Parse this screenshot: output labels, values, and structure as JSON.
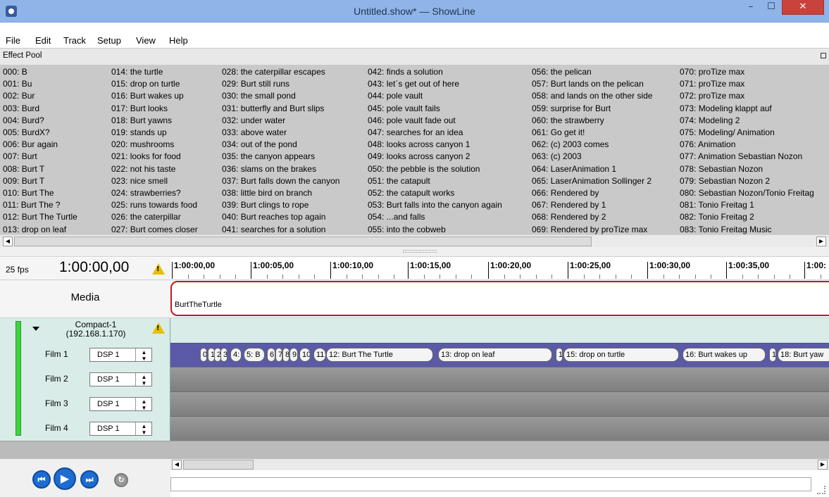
{
  "window": {
    "title": "Untitled.show* — ShowLine",
    "close_glyph": "✕",
    "max_glyph": "☐",
    "min_glyph": "–"
  },
  "menu": [
    "File",
    "Edit",
    "Track",
    "Setup",
    "View",
    "Help"
  ],
  "effect_pool": {
    "title": "Effect Pool",
    "columns": [
      [
        "000: B",
        "001: Bu",
        "002: Bur",
        "003: Burd",
        "004: Burd?",
        "005: BurdX?",
        "006: Bur again",
        "007: Burt",
        "008: Burt T",
        "009: Burt T",
        "010: Burt The",
        "011: Burt The ?",
        "012: Burt The Turtle",
        "013: drop on leaf"
      ],
      [
        "014: the turtle",
        "015: drop on turtle",
        "016: Burt wakes up",
        "017: Burt looks",
        "018: Burt yawns",
        "019: stands up",
        "020: mushrooms",
        "021: looks for food",
        "022: not his taste",
        "023: nice smell",
        "024: strawberries?",
        "025: runs towards food",
        "026: the caterpillar",
        "027: Burt comes closer"
      ],
      [
        "028: the caterpillar escapes",
        "029: Burt still runs",
        "030: the small pond",
        "031: butterfly and Burt slips",
        "032: under water",
        "033: above water",
        "034: out of the pond",
        "035: the canyon appears",
        "036: slams on the brakes",
        "037: Burt falls down the canyon",
        "038: little bird on branch",
        "039: Burt clings to rope",
        "040: Burt reaches top again",
        "041: searches for a solution"
      ],
      [
        "042: finds a solution",
        "043: let´s get out of here",
        "044: pole vault",
        "045: pole vault fails",
        "046: pole vault fade out",
        "047: searches for an idea",
        "048: looks across canyon 1",
        "049: looks across canyon 2",
        "050: the pebble is the solution",
        "051: the catapult",
        "052: the catapult works",
        "053: Burt falls into the canyon again",
        "054: ...and falls",
        "055: into the cobweb"
      ],
      [
        "056: the pelican",
        "057: Burt lands on the pelican",
        "058: and lands on the other side",
        "059: surprise for Burt",
        "060: the strawberry",
        "061: Go get it!",
        "062: (c) 2003 comes",
        "063: (c) 2003",
        "064: LaserAnimation 1",
        "065: LaserAnimation Sollinger 2",
        "066: Rendered by",
        "067: Rendered by 1",
        "068: Rendered by 2",
        "069: Rendered by proTize max"
      ],
      [
        "070: proTize max",
        "071: proTize max",
        "072: proTize max",
        "073: Modeling klappt auf",
        "074: Modeling 2",
        "075: Modeling/ Animation",
        "076: Animation",
        "077: Animation Sebastian Nozon",
        "078: Sebastian Nozon",
        "079: Sebastian Nozon 2",
        "080: Sebastian Nozon/Tonio Freitag",
        "081: Tonio Freitag 1",
        "082: Tonio Freitag 2",
        "083: Tonio Freitag Music"
      ]
    ]
  },
  "timeline": {
    "fps": "25 fps",
    "timecode": "1:00:00,00",
    "ticks": [
      "1:00:00,00",
      "1:00:05,00",
      "1:00:10,00",
      "1:00:15,00",
      "1:00:20,00",
      "1:00:25,00",
      "1:00:30,00",
      "1:00:35,00",
      "1:00:"
    ]
  },
  "media": {
    "label": "Media",
    "clip": "BurtTheTurtle"
  },
  "device": {
    "name_line1": "Compact-1",
    "name_line2": "(192.168.1.170)",
    "status_color": "#3dd43d"
  },
  "tracks": [
    {
      "label": "Film 1",
      "dsp": "DSP 1"
    },
    {
      "label": "Film 2",
      "dsp": "DSP 1"
    },
    {
      "label": "Film 3",
      "dsp": "DSP 1"
    },
    {
      "label": "Film 4",
      "dsp": "DSP 1"
    }
  ],
  "cues_film1": [
    "0",
    "1",
    "2",
    "3",
    "4:",
    "5: B",
    "6",
    "7",
    "8",
    "9",
    "10",
    "11:",
    "12: Burt The Turtle",
    "13: drop on leaf",
    "1",
    "15: drop on turtle",
    "16: Burt wakes up",
    "1",
    "18: Burt yaw"
  ],
  "colors": {
    "accent_blue": "#1e6cd0",
    "media_outline": "#c41a1a",
    "film1_lane": "#5a5aa8",
    "device_bg": "#d9ece8"
  },
  "transport": {
    "rewind": "⏮",
    "play": "▶",
    "forward": "⏭",
    "reload": "↻"
  }
}
